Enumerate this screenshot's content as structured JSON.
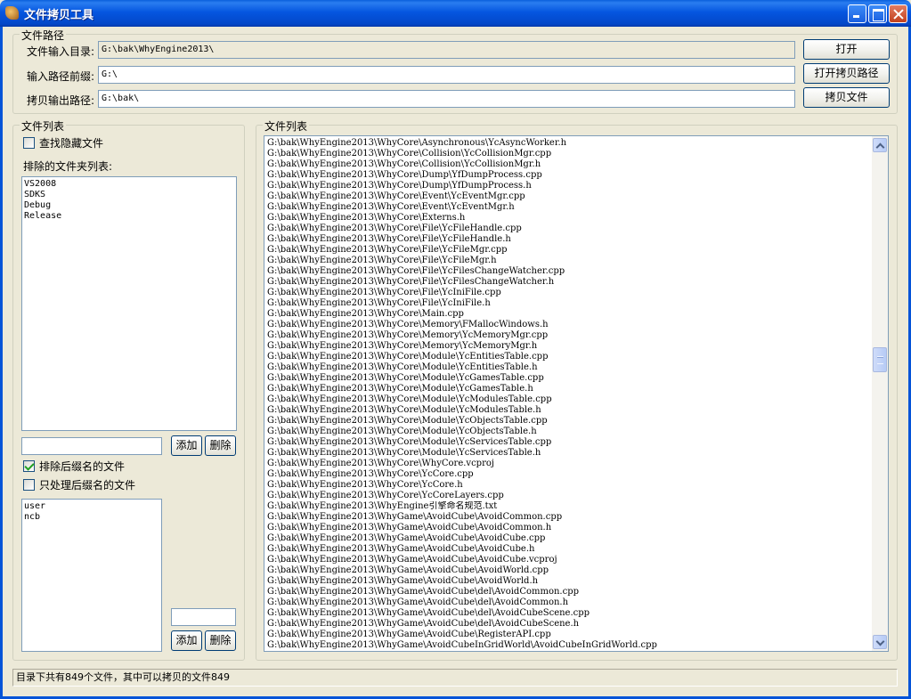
{
  "window": {
    "title": "文件拷贝工具"
  },
  "paths": {
    "legend": "文件路径",
    "input_dir_label": "文件输入目录:",
    "input_dir_value": "G:\\bak\\WhyEngine2013\\",
    "prefix_label": "输入路径前缀:",
    "prefix_value": "G:\\",
    "output_label": "拷贝输出路径:",
    "output_value": "G:\\bak\\",
    "open_button": "打开",
    "open_copy_path_button": "打开拷贝路径",
    "copy_files_button": "拷贝文件"
  },
  "left_panel": {
    "legend": "文件列表",
    "find_hidden_label": "查找隐藏文件",
    "find_hidden_checked": false,
    "excluded_folders_label": "排除的文件夹列表:",
    "excluded_folders": [
      "VS2008",
      "SDKS",
      "Debug",
      "Release"
    ],
    "folder_input_value": "",
    "add_button": "添加",
    "delete_button": "删除",
    "exclude_suffix_label": "排除后缀名的文件",
    "exclude_suffix_checked": true,
    "only_suffix_label": "只处理后缀名的文件",
    "only_suffix_checked": false,
    "suffixes": [
      "user",
      "ncb"
    ],
    "suffix_input_value": "",
    "add_button_2": "添加",
    "delete_button_2": "删除"
  },
  "right_panel": {
    "legend": "文件列表",
    "files": [
      "G:\\bak\\WhyEngine2013\\WhyCore\\Asynchronous\\YcAsyncWorker.h",
      "G:\\bak\\WhyEngine2013\\WhyCore\\Collision\\YcCollisionMgr.cpp",
      "G:\\bak\\WhyEngine2013\\WhyCore\\Collision\\YcCollisionMgr.h",
      "G:\\bak\\WhyEngine2013\\WhyCore\\Dump\\YfDumpProcess.cpp",
      "G:\\bak\\WhyEngine2013\\WhyCore\\Dump\\YfDumpProcess.h",
      "G:\\bak\\WhyEngine2013\\WhyCore\\Event\\YcEventMgr.cpp",
      "G:\\bak\\WhyEngine2013\\WhyCore\\Event\\YcEventMgr.h",
      "G:\\bak\\WhyEngine2013\\WhyCore\\Externs.h",
      "G:\\bak\\WhyEngine2013\\WhyCore\\File\\YcFileHandle.cpp",
      "G:\\bak\\WhyEngine2013\\WhyCore\\File\\YcFileHandle.h",
      "G:\\bak\\WhyEngine2013\\WhyCore\\File\\YcFileMgr.cpp",
      "G:\\bak\\WhyEngine2013\\WhyCore\\File\\YcFileMgr.h",
      "G:\\bak\\WhyEngine2013\\WhyCore\\File\\YcFilesChangeWatcher.cpp",
      "G:\\bak\\WhyEngine2013\\WhyCore\\File\\YcFilesChangeWatcher.h",
      "G:\\bak\\WhyEngine2013\\WhyCore\\File\\YcIniFile.cpp",
      "G:\\bak\\WhyEngine2013\\WhyCore\\File\\YcIniFile.h",
      "G:\\bak\\WhyEngine2013\\WhyCore\\Main.cpp",
      "G:\\bak\\WhyEngine2013\\WhyCore\\Memory\\FMallocWindows.h",
      "G:\\bak\\WhyEngine2013\\WhyCore\\Memory\\YcMemoryMgr.cpp",
      "G:\\bak\\WhyEngine2013\\WhyCore\\Memory\\YcMemoryMgr.h",
      "G:\\bak\\WhyEngine2013\\WhyCore\\Module\\YcEntitiesTable.cpp",
      "G:\\bak\\WhyEngine2013\\WhyCore\\Module\\YcEntitiesTable.h",
      "G:\\bak\\WhyEngine2013\\WhyCore\\Module\\YcGamesTable.cpp",
      "G:\\bak\\WhyEngine2013\\WhyCore\\Module\\YcGamesTable.h",
      "G:\\bak\\WhyEngine2013\\WhyCore\\Module\\YcModulesTable.cpp",
      "G:\\bak\\WhyEngine2013\\WhyCore\\Module\\YcModulesTable.h",
      "G:\\bak\\WhyEngine2013\\WhyCore\\Module\\YcObjectsTable.cpp",
      "G:\\bak\\WhyEngine2013\\WhyCore\\Module\\YcObjectsTable.h",
      "G:\\bak\\WhyEngine2013\\WhyCore\\Module\\YcServicesTable.cpp",
      "G:\\bak\\WhyEngine2013\\WhyCore\\Module\\YcServicesTable.h",
      "G:\\bak\\WhyEngine2013\\WhyCore\\WhyCore.vcproj",
      "G:\\bak\\WhyEngine2013\\WhyCore\\YcCore.cpp",
      "G:\\bak\\WhyEngine2013\\WhyCore\\YcCore.h",
      "G:\\bak\\WhyEngine2013\\WhyCore\\YcCoreLayers.cpp",
      "G:\\bak\\WhyEngine2013\\WhyEngine引擎命名规范.txt",
      "G:\\bak\\WhyEngine2013\\WhyGame\\AvoidCube\\AvoidCommon.cpp",
      "G:\\bak\\WhyEngine2013\\WhyGame\\AvoidCube\\AvoidCommon.h",
      "G:\\bak\\WhyEngine2013\\WhyGame\\AvoidCube\\AvoidCube.cpp",
      "G:\\bak\\WhyEngine2013\\WhyGame\\AvoidCube\\AvoidCube.h",
      "G:\\bak\\WhyEngine2013\\WhyGame\\AvoidCube\\AvoidCube.vcproj",
      "G:\\bak\\WhyEngine2013\\WhyGame\\AvoidCube\\AvoidWorld.cpp",
      "G:\\bak\\WhyEngine2013\\WhyGame\\AvoidCube\\AvoidWorld.h",
      "G:\\bak\\WhyEngine2013\\WhyGame\\AvoidCube\\del\\AvoidCommon.cpp",
      "G:\\bak\\WhyEngine2013\\WhyGame\\AvoidCube\\del\\AvoidCommon.h",
      "G:\\bak\\WhyEngine2013\\WhyGame\\AvoidCube\\del\\AvoidCubeScene.cpp",
      "G:\\bak\\WhyEngine2013\\WhyGame\\AvoidCube\\del\\AvoidCubeScene.h",
      "G:\\bak\\WhyEngine2013\\WhyGame\\AvoidCube\\RegisterAPI.cpp",
      "G:\\bak\\WhyEngine2013\\WhyGame\\AvoidCubeInGridWorld\\AvoidCubeInGridWorld.cpp"
    ]
  },
  "status": {
    "text": "目录下共有849个文件，其中可以拷贝的文件849"
  }
}
